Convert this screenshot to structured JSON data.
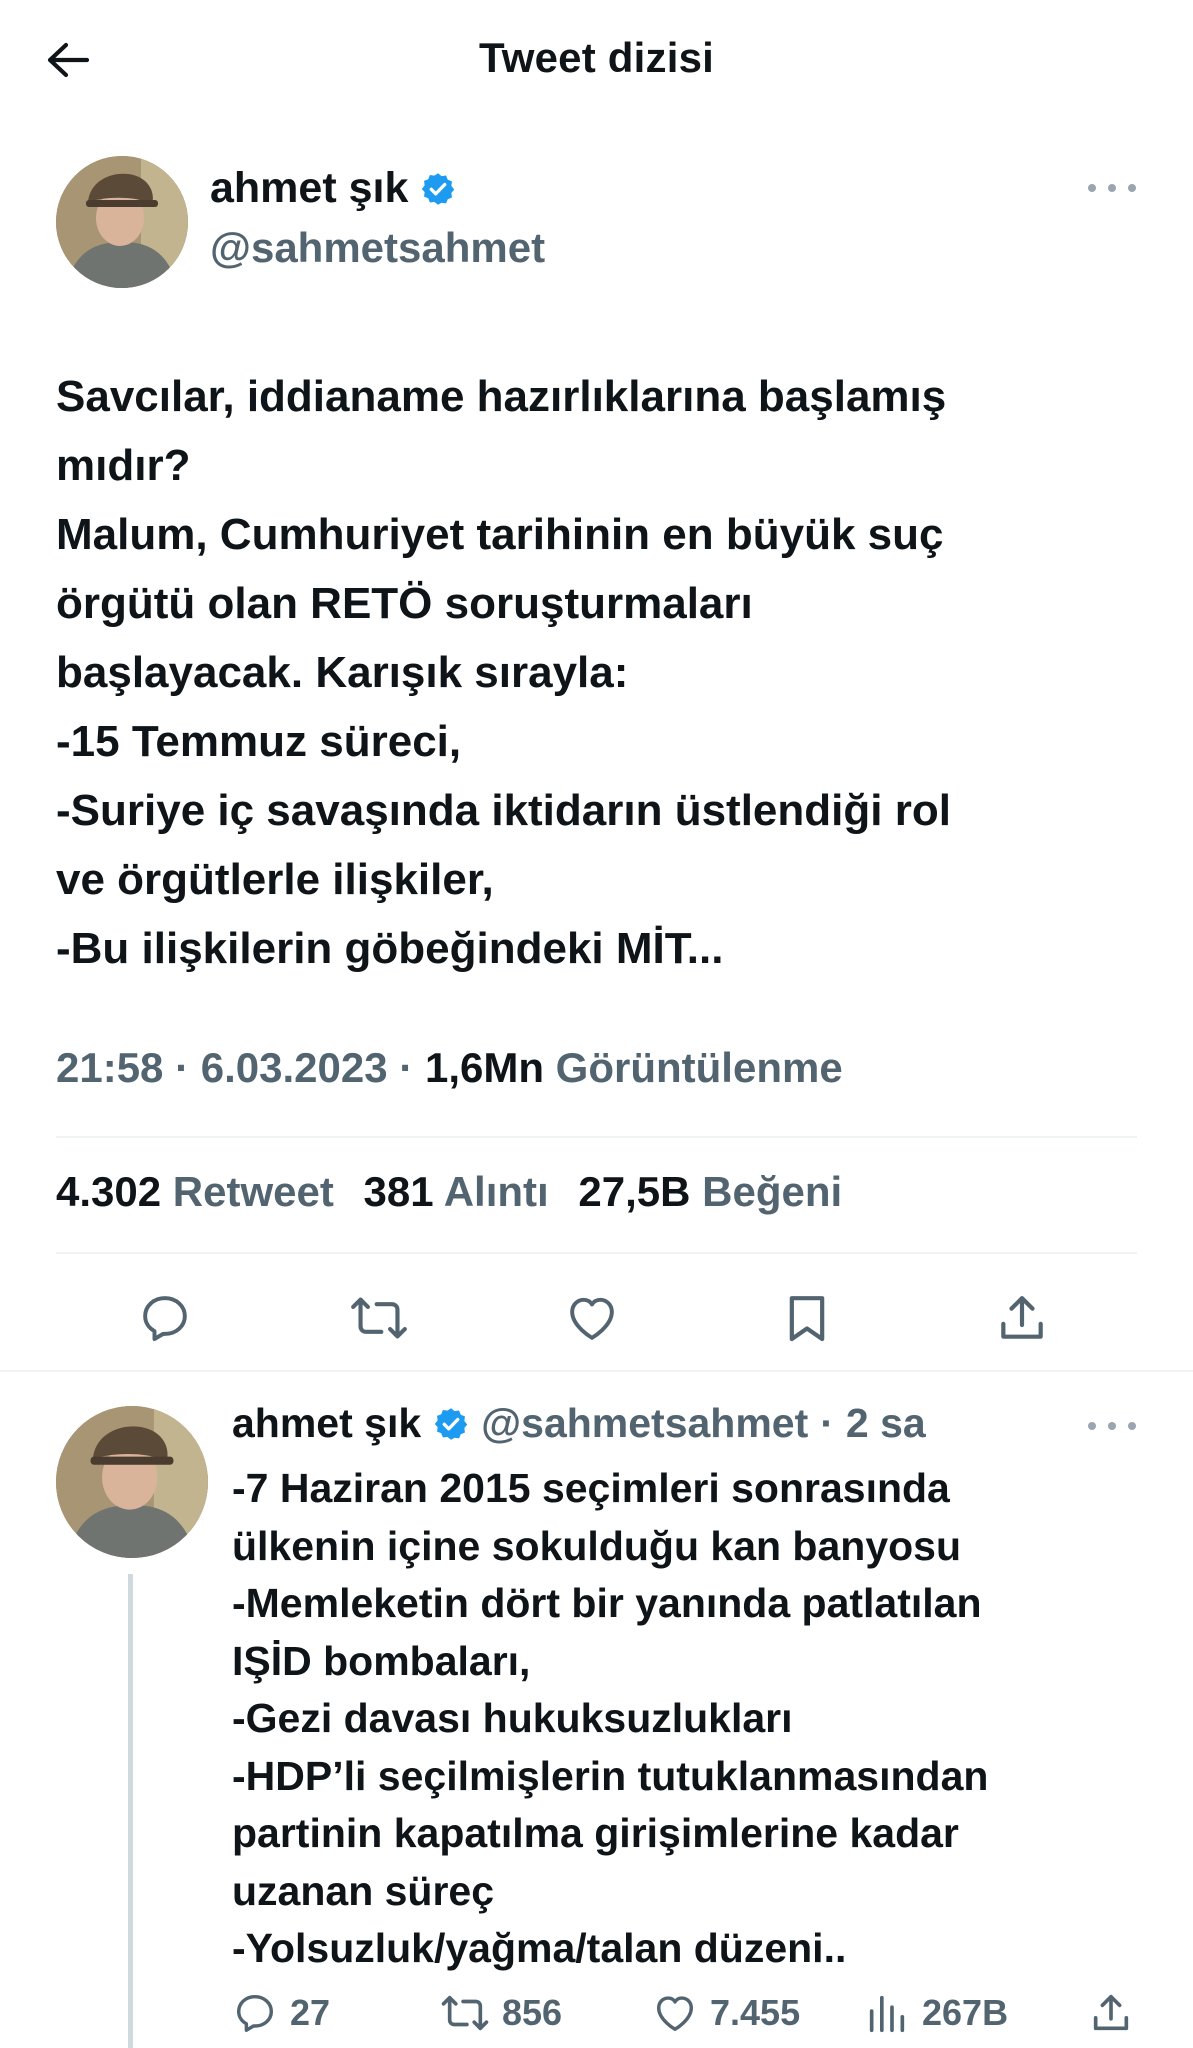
{
  "header": {
    "title": "Tweet dizisi",
    "back_icon": "arrow-left-icon"
  },
  "main_tweet": {
    "author_name": "ahmet şık",
    "handle": "@sahmetsahmet",
    "verified": true,
    "text_lines": [
      "Savcılar, iddianame hazırlıklarına başlamış",
      "mıdır?",
      "Malum, Cumhuriyet tarihinin en büyük suç",
      "örgütü olan RETÖ soruşturmaları",
      "başlayacak. Karışık sırayla:",
      "-15 Temmuz süreci,",
      "-Suriye iç savaşında iktidarın üstlendiği rol",
      "ve örgütlerle ilişkiler,",
      "-Bu ilişkilerin göbeğindeki MİT..."
    ],
    "time": "21:58",
    "date": "6.03.2023",
    "separator": "·",
    "views_count": "1,6Mn",
    "views_label": "Görüntülenme",
    "stats": {
      "retweets_count": "4.302",
      "retweets_label": "Retweet",
      "quotes_count": "381",
      "quotes_label": "Alıntı",
      "likes_count": "27,5B",
      "likes_label": "Beğeni"
    },
    "action_icons": [
      "reply-icon",
      "retweet-icon",
      "like-icon",
      "bookmark-icon",
      "share-icon"
    ]
  },
  "reply_tweet": {
    "author_name": "ahmet şık",
    "handle": "@sahmetsahmet",
    "separator": "·",
    "time_ago": "2 sa",
    "verified": true,
    "text_lines": [
      "-7 Haziran 2015 seçimleri sonrasında",
      "ülkenin içine sokulduğu kan banyosu",
      "-Memleketin dört bir yanında patlatılan",
      "IŞİD bombaları,",
      "-Gezi davası hukuksuzlukları",
      "-HDP’li seçilmişlerin tutuklanmasından",
      "partinin kapatılma girişimlerine kadar",
      "uzanan süreç",
      "-Yolsuzluk/yağma/talan düzeni.."
    ],
    "actions": {
      "replies": "27",
      "retweets": "856",
      "likes": "7.455",
      "views": "267B"
    }
  },
  "colors": {
    "text": "#0f1419",
    "secondary": "#536471",
    "verified": "#1d9bf0",
    "divider": "#eff3f4"
  }
}
